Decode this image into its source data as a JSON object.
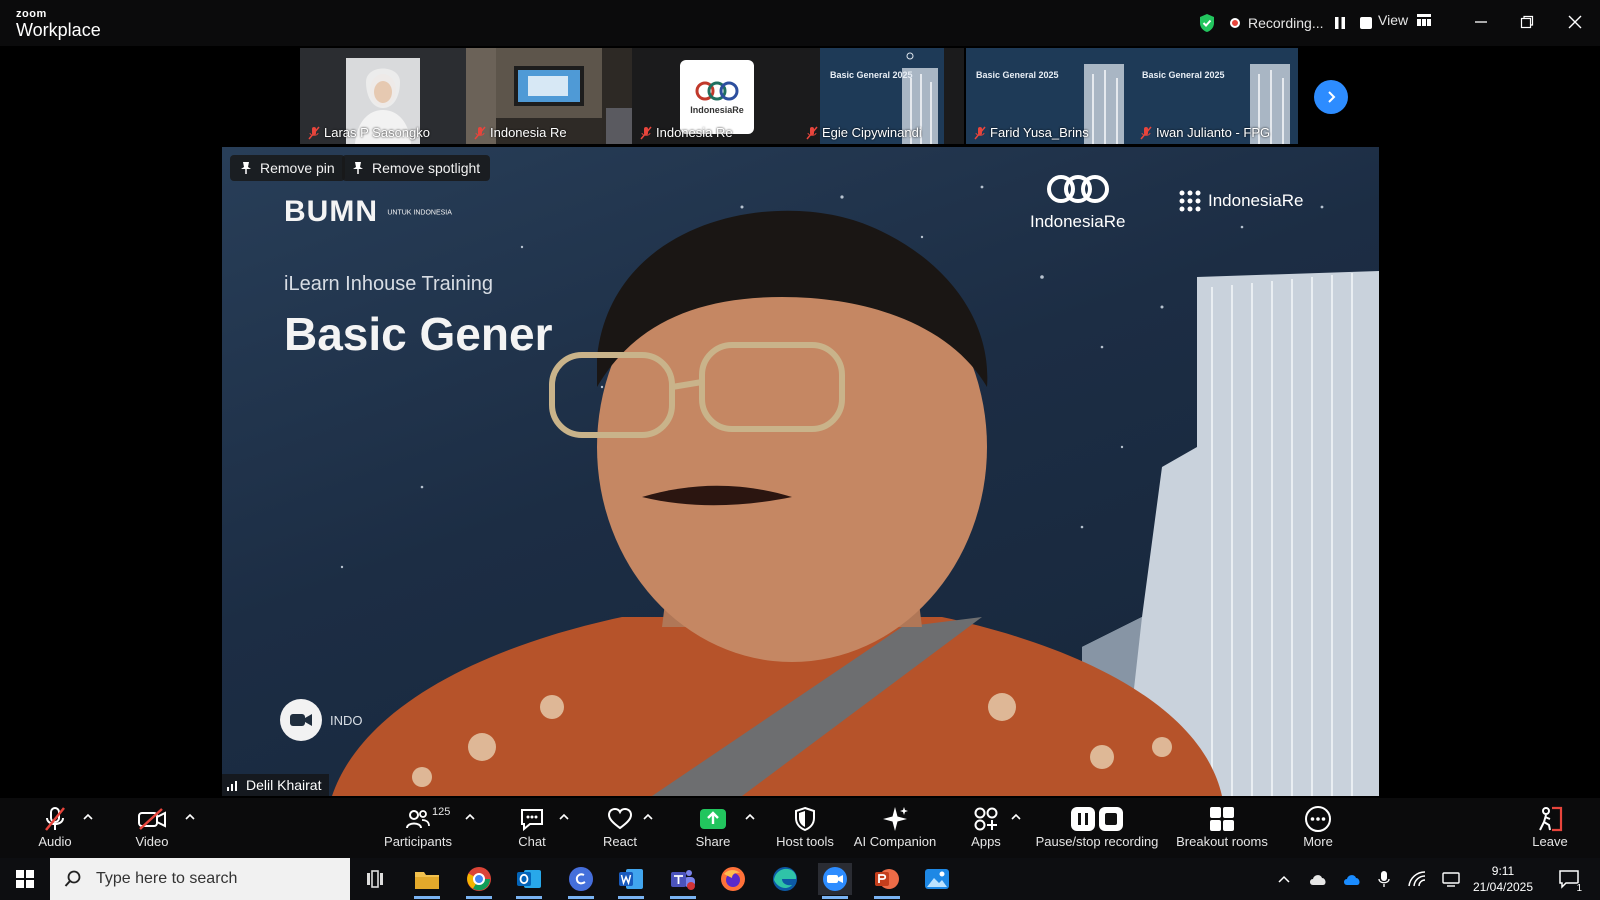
{
  "app": {
    "logo_small": "zoom",
    "logo_big": "Workplace"
  },
  "titlebar": {
    "recording_label": "Recording...",
    "view_label": "View"
  },
  "thumbnails": [
    {
      "name": "Laras P Sasongko"
    },
    {
      "name": "Indonesia Re"
    },
    {
      "name": "Indonesia Re"
    },
    {
      "name": "Egie Cipywinandi"
    },
    {
      "name": "Farid Yusa_Brins"
    },
    {
      "name": "Iwan Julianto - FPG"
    }
  ],
  "thumbnail_slide_text": "Basic General 2025",
  "thumbnail_logo_text": "IndonesiaRe",
  "main_video": {
    "remove_pin_label": "Remove pin",
    "remove_spotlight_label": "Remove spotlight",
    "speaker_name": "Delil Khairat",
    "slide": {
      "logo": "BUMN",
      "logo_small": "UNTUK INDONESIA",
      "subtitle": "iLearn Inhouse Training",
      "title": "Basic Gener",
      "brand1": "IndonesiaRe",
      "brand2": "IndonesiaRe",
      "corner_text": "INDO"
    }
  },
  "toolbar": {
    "audio": "Audio",
    "video": "Video",
    "participants": "Participants",
    "participants_count": "125",
    "chat": "Chat",
    "react": "React",
    "share": "Share",
    "host_tools": "Host tools",
    "ai_companion": "AI Companion",
    "apps": "Apps",
    "pause_stop_recording": "Pause/stop recording",
    "breakout_rooms": "Breakout rooms",
    "more": "More",
    "leave": "Leave"
  },
  "taskbar": {
    "search_placeholder": "Type here to search",
    "time": "9:11",
    "date": "21/04/2025",
    "notification_count": "1"
  },
  "colors": {
    "accent": "#2d8cff",
    "share_green": "#22c55e",
    "muted_red": "#e8453c",
    "shield_green": "#22c55e"
  }
}
